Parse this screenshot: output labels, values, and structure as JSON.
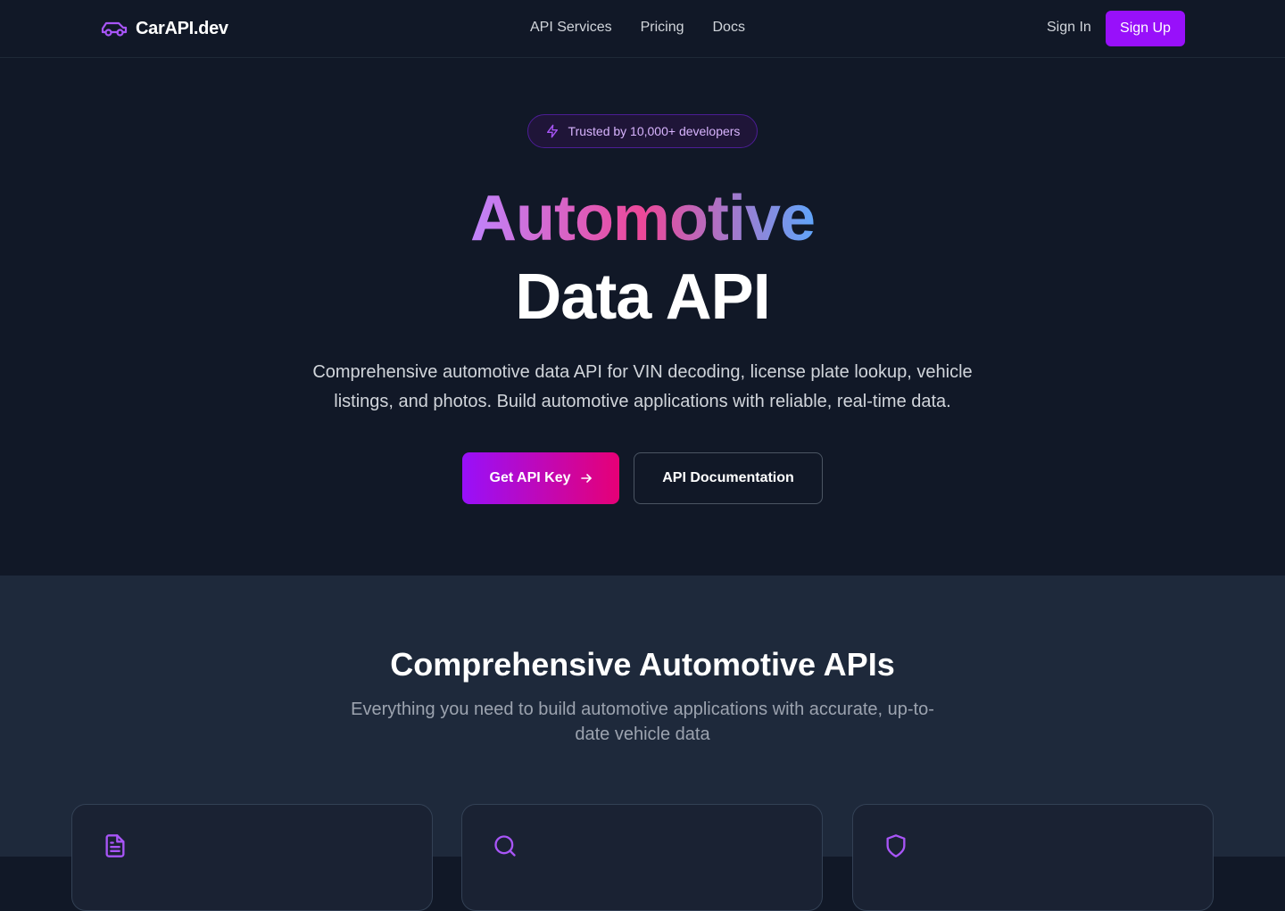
{
  "brand": {
    "name": "CarAPI.dev",
    "accent": "#9810fa"
  },
  "nav": {
    "links": [
      "API Services",
      "Pricing",
      "Docs"
    ],
    "sign_in": "Sign In",
    "sign_up": "Sign Up"
  },
  "hero": {
    "badge": "Trusted by 10,000+ developers",
    "title_gradient": "Automotive",
    "title_plain": "Data API",
    "description": "Comprehensive automotive data API for VIN decoding, license plate lookup, vehicle listings, and photos. Build automotive applications with reliable, real-time data.",
    "primary_cta": "Get API Key",
    "secondary_cta": "API Documentation"
  },
  "features": {
    "title": "Comprehensive Automotive APIs",
    "subtitle": "Everything you need to build automotive applications with accurate, up-to-date vehicle data",
    "cards": [
      {
        "icon": "document-icon"
      },
      {
        "icon": "search-icon"
      },
      {
        "icon": "shield-icon"
      }
    ]
  }
}
